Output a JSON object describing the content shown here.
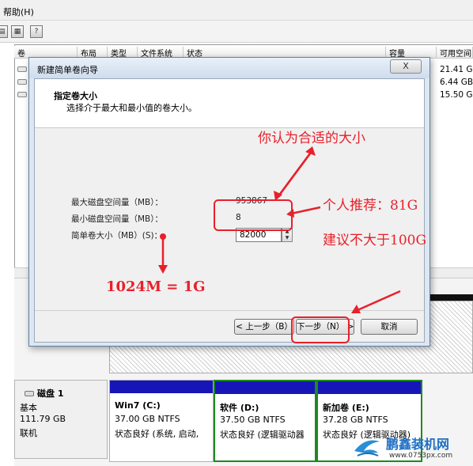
{
  "menu": {
    "help": "帮助(H)"
  },
  "toolbar": {
    "icons": [
      "disk-icon",
      "properties-icon",
      "help-icon"
    ]
  },
  "volume_list": {
    "columns": [
      "卷",
      "布局",
      "类型",
      "文件系统",
      "状态",
      "容量",
      "可用空间"
    ],
    "free_space": [
      "21.41 G",
      "6.44 GB",
      "15.50 G"
    ]
  },
  "dialog": {
    "title": "新建简单卷向导",
    "close": "X",
    "header_title": "指定卷大小",
    "header_subtitle": "选择介于最大和最小值的卷大小。",
    "max_label": "最大磁盘空间量（MB）：",
    "max_value": "953867",
    "min_label": "最小磁盘空间量（MB）：",
    "min_value": "8",
    "size_label": "简单卷大小（MB）(S)：",
    "size_value": "82000",
    "back": "< 上一步（B）",
    "next": "下一步（N） >",
    "cancel": "取消"
  },
  "disk": {
    "name": "磁盘 1",
    "type": "基本",
    "size": "111.79 GB",
    "status": "联机",
    "partitions": [
      {
        "name": "Win7  (C:)",
        "size": "37.00 GB NTFS",
        "status": "状态良好 (系统, 启动,"
      },
      {
        "name": "软件  (D:)",
        "size": "37.50 GB NTFS",
        "status": "状态良好 (逻辑驱动器"
      },
      {
        "name": "新加卷  (E:)",
        "size": "37.28 GB NTFS",
        "status": "状态良好 (逻辑驱动器)"
      }
    ]
  },
  "annotations": {
    "suitable": "你认为合适的大小",
    "recommend": "个人推荐：81G",
    "advice": "建议不大于100G",
    "conversion": "1024M = 1G"
  },
  "watermark": {
    "name": "鹏鑫装机网",
    "url": "www.0753px.com"
  },
  "colors": {
    "annotation_red": "#e8202a",
    "partition_strip": "#1616b8",
    "selection_green": "#1e8a1e"
  }
}
